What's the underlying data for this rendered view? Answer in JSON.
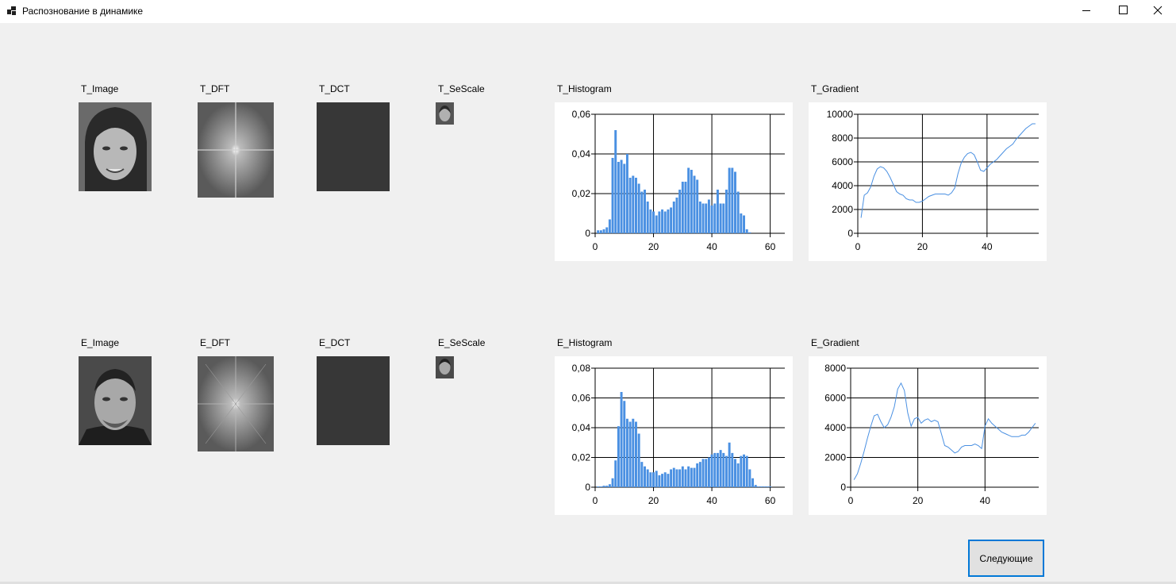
{
  "window": {
    "title": "Распознование в динамике",
    "controls": [
      "minimize-icon",
      "maximize-icon",
      "close-icon"
    ]
  },
  "labels": {
    "t_image": "T_Image",
    "t_dft": "T_DFT",
    "t_dct": "T_DCT",
    "t_sescale": "T_SeScale",
    "t_histogram": "T_Histogram",
    "t_gradient": "T_Gradient",
    "e_image": "E_Image",
    "e_dft": "E_DFT",
    "e_dct": "E_DCT",
    "e_sescale": "E_SeScale",
    "e_histogram": "E_Histogram",
    "e_gradient": "E_Gradient"
  },
  "button": {
    "next_label": "Следующие"
  },
  "colors": {
    "series": "#4a90e2",
    "dct_fill": "#373737",
    "window_bg": "#f0f0f0",
    "button_border": "#0078d7"
  },
  "chart_data": [
    {
      "id": "t_histogram",
      "type": "bar",
      "xlim": [
        0,
        65
      ],
      "ylim": [
        0,
        0.06
      ],
      "xticks": [
        0,
        20,
        40,
        60
      ],
      "yticks": [
        0,
        0.02,
        0.04,
        0.06
      ],
      "xtick_labels": [
        "0",
        "20",
        "40",
        "60"
      ],
      "ytick_labels": [
        "0",
        "0,02",
        "0,04",
        "0,06"
      ],
      "grid": true,
      "x": [
        1,
        2,
        3,
        4,
        5,
        6,
        7,
        8,
        9,
        10,
        11,
        12,
        13,
        14,
        15,
        16,
        17,
        18,
        19,
        20,
        21,
        22,
        23,
        24,
        25,
        26,
        27,
        28,
        29,
        30,
        31,
        32,
        33,
        34,
        35,
        36,
        37,
        38,
        39,
        40,
        41,
        42,
        43,
        44,
        45,
        46,
        47,
        48,
        49,
        50,
        51,
        52,
        53
      ],
      "values": [
        0.0015,
        0.0015,
        0.002,
        0.003,
        0.007,
        0.038,
        0.052,
        0.036,
        0.037,
        0.035,
        0.04,
        0.028,
        0.029,
        0.028,
        0.025,
        0.021,
        0.022,
        0.016,
        0.012,
        0.011,
        0.009,
        0.011,
        0.012,
        0.011,
        0.012,
        0.013,
        0.016,
        0.018,
        0.022,
        0.026,
        0.026,
        0.033,
        0.032,
        0.029,
        0.027,
        0.016,
        0.015,
        0.015,
        0.017,
        0.014,
        0.015,
        0.022,
        0.015,
        0.015,
        0.022,
        0.033,
        0.033,
        0.031,
        0.021,
        0.01,
        0.009,
        0.002,
        0.0005
      ]
    },
    {
      "id": "t_gradient",
      "type": "line",
      "xlim": [
        0,
        56
      ],
      "ylim": [
        0,
        10000
      ],
      "xticks": [
        0,
        20,
        40
      ],
      "yticks": [
        0,
        2000,
        4000,
        6000,
        8000,
        10000
      ],
      "xtick_labels": [
        "0",
        "20",
        "40"
      ],
      "ytick_labels": [
        "0",
        "2000",
        "4000",
        "6000",
        "8000",
        "10000"
      ],
      "grid": true,
      "x": [
        1,
        2,
        3,
        4,
        5,
        6,
        7,
        8,
        9,
        10,
        11,
        12,
        13,
        14,
        15,
        16,
        17,
        18,
        19,
        20,
        21,
        22,
        23,
        24,
        25,
        26,
        27,
        28,
        29,
        30,
        31,
        32,
        33,
        34,
        35,
        36,
        37,
        38,
        39,
        40,
        41,
        42,
        43,
        44,
        45,
        46,
        47,
        48,
        49,
        50,
        51,
        52,
        53,
        54,
        55
      ],
      "values": [
        1300,
        3200,
        3400,
        3900,
        4800,
        5400,
        5600,
        5500,
        5200,
        4700,
        4100,
        3500,
        3300,
        3200,
        2900,
        2800,
        2800,
        2600,
        2600,
        2700,
        2900,
        3100,
        3200,
        3300,
        3300,
        3300,
        3300,
        3200,
        3400,
        3800,
        5000,
        5900,
        6400,
        6700,
        6800,
        6600,
        6000,
        5300,
        5200,
        5500,
        5800,
        6000,
        6200,
        6500,
        6800,
        7100,
        7300,
        7500,
        7900,
        8200,
        8500,
        8800,
        9000,
        9200,
        9200
      ]
    },
    {
      "id": "e_histogram",
      "type": "bar",
      "xlim": [
        0,
        65
      ],
      "ylim": [
        0,
        0.08
      ],
      "xticks": [
        0,
        20,
        40,
        60
      ],
      "yticks": [
        0,
        0.02,
        0.04,
        0.06,
        0.08
      ],
      "xtick_labels": [
        "0",
        "20",
        "40",
        "60"
      ],
      "ytick_labels": [
        "0",
        "0,02",
        "0,04",
        "0,06",
        "0,08"
      ],
      "grid": true,
      "x": [
        1,
        2,
        3,
        4,
        5,
        6,
        7,
        8,
        9,
        10,
        11,
        12,
        13,
        14,
        15,
        16,
        17,
        18,
        19,
        20,
        21,
        22,
        23,
        24,
        25,
        26,
        27,
        28,
        29,
        30,
        31,
        32,
        33,
        34,
        35,
        36,
        37,
        38,
        39,
        40,
        41,
        42,
        43,
        44,
        45,
        46,
        47,
        48,
        49,
        50,
        51,
        52,
        53,
        54,
        55,
        56,
        57,
        58,
        59,
        60
      ],
      "values": [
        0.0005,
        0.0005,
        0.001,
        0.001,
        0.002,
        0.006,
        0.018,
        0.041,
        0.064,
        0.058,
        0.046,
        0.044,
        0.046,
        0.044,
        0.036,
        0.017,
        0.014,
        0.012,
        0.01,
        0.01,
        0.011,
        0.008,
        0.009,
        0.01,
        0.009,
        0.012,
        0.013,
        0.012,
        0.012,
        0.014,
        0.012,
        0.014,
        0.013,
        0.013,
        0.016,
        0.017,
        0.019,
        0.019,
        0.02,
        0.022,
        0.023,
        0.023,
        0.025,
        0.023,
        0.021,
        0.03,
        0.023,
        0.019,
        0.016,
        0.021,
        0.022,
        0.021,
        0.012,
        0.006,
        0.0015,
        0.0005,
        0.0005,
        0.0005,
        0.0005,
        0.0005
      ]
    },
    {
      "id": "e_gradient",
      "type": "line",
      "xlim": [
        0,
        56
      ],
      "ylim": [
        0,
        8000
      ],
      "xticks": [
        0,
        20,
        40
      ],
      "yticks": [
        0,
        2000,
        4000,
        6000,
        8000
      ],
      "xtick_labels": [
        "0",
        "20",
        "40"
      ],
      "ytick_labels": [
        "0",
        "2000",
        "4000",
        "6000",
        "8000"
      ],
      "grid": true,
      "x": [
        1,
        2,
        3,
        4,
        5,
        6,
        7,
        8,
        9,
        10,
        11,
        12,
        13,
        14,
        15,
        16,
        17,
        18,
        19,
        20,
        21,
        22,
        23,
        24,
        25,
        26,
        27,
        28,
        29,
        30,
        31,
        32,
        33,
        34,
        35,
        36,
        37,
        38,
        39,
        40,
        41,
        42,
        43,
        44,
        45,
        46,
        47,
        48,
        49,
        50,
        51,
        52,
        53,
        54,
        55
      ],
      "values": [
        500,
        900,
        1600,
        2400,
        3300,
        4100,
        4800,
        4900,
        4400,
        4000,
        4200,
        4700,
        5400,
        6600,
        7000,
        6500,
        5000,
        4100,
        4600,
        4700,
        4300,
        4500,
        4600,
        4400,
        4500,
        4400,
        3600,
        2800,
        2700,
        2500,
        2300,
        2400,
        2700,
        2800,
        2800,
        2800,
        2900,
        2800,
        2600,
        4100,
        4600,
        4300,
        4100,
        3900,
        3700,
        3600,
        3500,
        3400,
        3400,
        3400,
        3500,
        3500,
        3700,
        4000,
        4300
      ]
    }
  ]
}
